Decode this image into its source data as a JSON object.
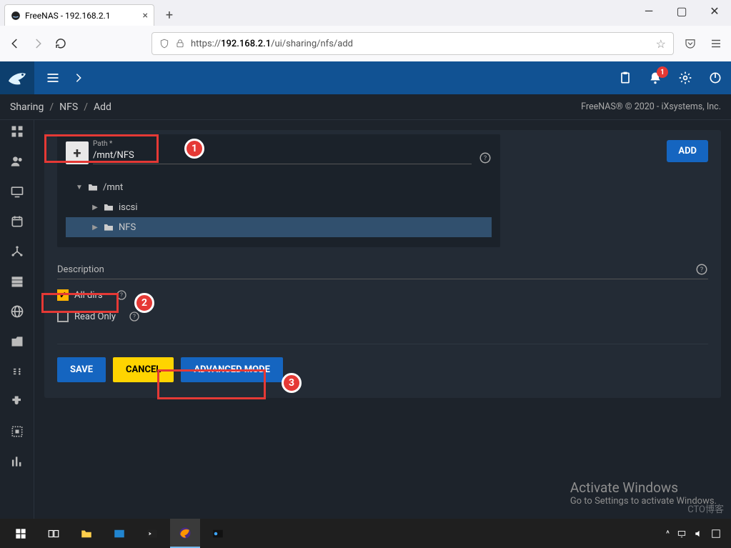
{
  "browser": {
    "tab_title": "FreeNAS - 192.168.2.1",
    "url_prefix": "https://",
    "url_host": "192.168.2.1",
    "url_path": "/ui/sharing/nfs/add"
  },
  "topbar": {
    "badge": "1"
  },
  "breadcrumb": {
    "a": "Sharing",
    "b": "NFS",
    "c": "Add",
    "copy": "FreeNAS® © 2020 - iXsystems, Inc."
  },
  "form": {
    "path_label": "Path *",
    "path_value": "/mnt/NFS",
    "add_btn": "ADD",
    "tree": {
      "root": "/mnt",
      "c1": "iscsi",
      "c2": "NFS"
    },
    "desc_label": "Description",
    "all_dirs": "All dirs",
    "read_only": "Read Only",
    "save": "SAVE",
    "cancel": "CANCEL",
    "advanced": "ADVANCED MODE"
  },
  "annot": {
    "n1": "1",
    "n2": "2",
    "n3": "3"
  },
  "watermark": {
    "l1": "Activate Windows",
    "l2": "Go to Settings to activate Windows."
  },
  "cto": "CTO博客"
}
